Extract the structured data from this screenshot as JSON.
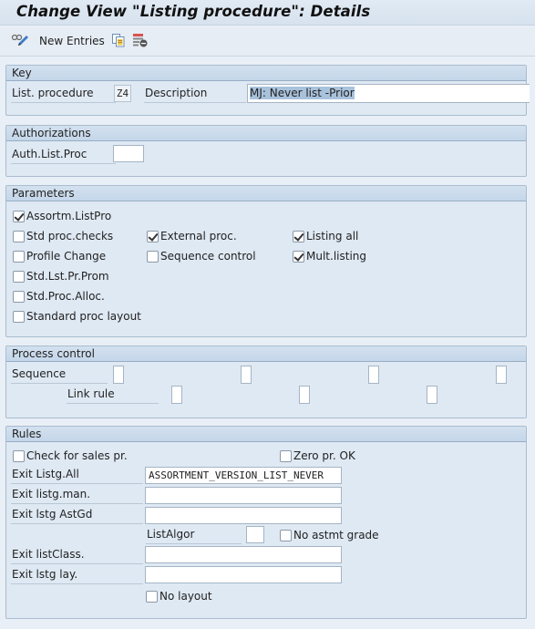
{
  "window": {
    "title": "Change View \"Listing procedure\": Details"
  },
  "toolbar": {
    "items": [
      {
        "icon": "display-change-icon",
        "label": ""
      },
      {
        "icon": "",
        "label": "New Entries"
      },
      {
        "icon": "copy-icon",
        "label": ""
      },
      {
        "icon": "delete-icon",
        "label": ""
      }
    ],
    "new_entries_label": "New Entries"
  },
  "key": {
    "title": "Key",
    "list_procedure_label": "List. procedure",
    "list_procedure_value": "Z4",
    "description_label": "Description",
    "description_value": "MJ: Never list -Prior"
  },
  "authorizations": {
    "title": "Authorizations",
    "auth_list_proc_label": "Auth.List.Proc",
    "auth_list_proc_value": ""
  },
  "parameters": {
    "title": "Parameters",
    "checkboxes": [
      {
        "label": "Assortm.ListPro",
        "checked": true
      },
      {
        "label": "Std proc.checks",
        "checked": false
      },
      {
        "label": "External proc.",
        "checked": true
      },
      {
        "label": "Listing all",
        "checked": true
      },
      {
        "label": "Profile Change",
        "checked": false
      },
      {
        "label": "Sequence control",
        "checked": false
      },
      {
        "label": "Mult.listing",
        "checked": true
      },
      {
        "label": "Std.Lst.Pr.Prom",
        "checked": false
      },
      {
        "label": "Std.Proc.Alloc.",
        "checked": false
      },
      {
        "label": "Standard proc layout",
        "checked": false
      }
    ]
  },
  "process_control": {
    "title": "Process control",
    "sequence_label": "Sequence",
    "sequence_values": [
      "",
      "",
      "",
      ""
    ],
    "link_rule_label": "Link rule",
    "link_rule_values": [
      "",
      "",
      ""
    ]
  },
  "rules": {
    "title": "Rules",
    "check_for_sales_pr": {
      "label": "Check for sales pr.",
      "checked": false
    },
    "zero_pr_ok": {
      "label": "Zero pr. OK",
      "checked": false
    },
    "exit_listg_all_label": "Exit Listg.All",
    "exit_listg_all_value": "ASSORTMENT_VERSION_LIST_NEVER",
    "exit_listg_man_label": "Exit listg.man.",
    "exit_listg_man_value": "",
    "exit_lstg_astgd_label": "Exit lstg AstGd",
    "exit_lstg_astgd_value": "",
    "list_algor_label": "ListAlgor",
    "list_algor_value": "",
    "no_astmt_grade": {
      "label": "No astmt grade",
      "checked": false
    },
    "exit_list_class_label": "Exit listClass.",
    "exit_list_class_value": "",
    "exit_lstg_lay_label": "Exit lstg lay.",
    "exit_lstg_lay_value": "",
    "no_layout": {
      "label": "No layout",
      "checked": false
    }
  }
}
